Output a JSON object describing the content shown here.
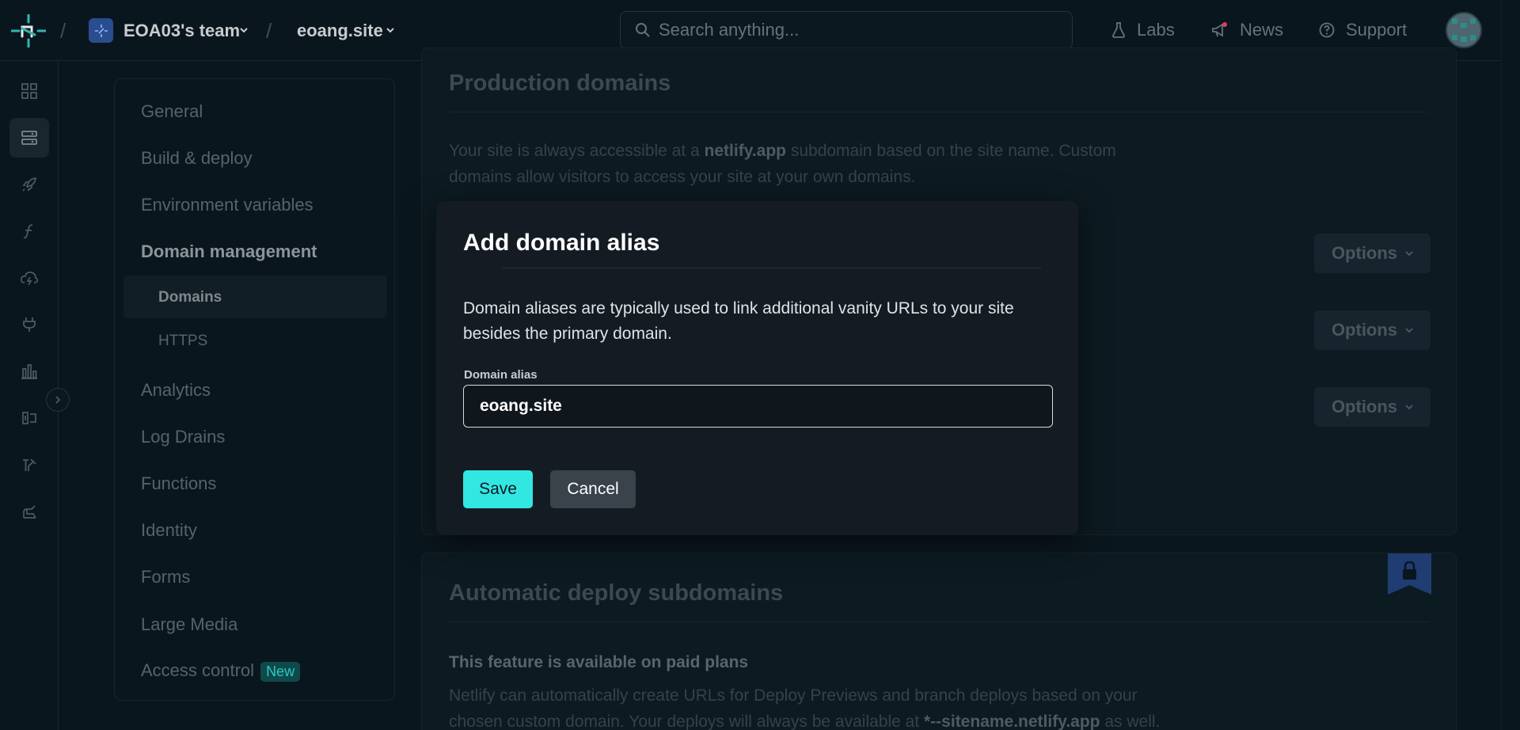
{
  "topbar": {
    "team_name": "EOA03's team",
    "site_name": "eoang.site",
    "search_placeholder": "Search anything...",
    "labs_label": "Labs",
    "news_label": "News",
    "support_label": "Support",
    "separator": "/"
  },
  "rail": {
    "items": [
      "dashboard-icon",
      "sites-icon",
      "deploy-icon",
      "functions-icon",
      "edge-icon",
      "integrations-icon",
      "analytics-icon",
      "forms-icon",
      "builds-icon",
      "team-icon"
    ],
    "active_index": 1
  },
  "settings_nav": {
    "items": [
      {
        "label": "General"
      },
      {
        "label": "Build & deploy"
      },
      {
        "label": "Environment variables"
      },
      {
        "label": "Domain management"
      },
      {
        "label": "Analytics"
      },
      {
        "label": "Log Drains"
      },
      {
        "label": "Functions"
      },
      {
        "label": "Identity"
      },
      {
        "label": "Forms"
      },
      {
        "label": "Large Media"
      },
      {
        "label": "Access control"
      }
    ],
    "sub_items": [
      {
        "label": "Domains"
      },
      {
        "label": "HTTPS"
      }
    ],
    "new_badge": "New"
  },
  "production_domains": {
    "title": "Production domains",
    "desc_pre": "Your site is always accessible at a ",
    "desc_bold": "netlify.app",
    "desc_post": " subdomain based on the site name. Custom domains allow visitors to access your site at your own domains.",
    "options_label": "Options"
  },
  "auto_deploy": {
    "title": "Automatic deploy subdomains",
    "paid_notice": "This feature is available on paid plans",
    "desc_pre": "Netlify can automatically create URLs for Deploy Previews and branch deploys based on your chosen custom domain. Your deploys will always be available at ",
    "desc_bold": "*--sitename.netlify.app",
    "desc_post": " as well."
  },
  "modal": {
    "title": "Add domain alias",
    "description": "Domain aliases are typically used to link additional vanity URLs to your site besides the primary domain.",
    "field_label": "Domain alias",
    "field_value": "eoang.site",
    "save_label": "Save",
    "cancel_label": "Cancel"
  },
  "colors": {
    "accent": "#32e6e2",
    "background": "#0a161d",
    "modal_bg": "#141b22"
  }
}
